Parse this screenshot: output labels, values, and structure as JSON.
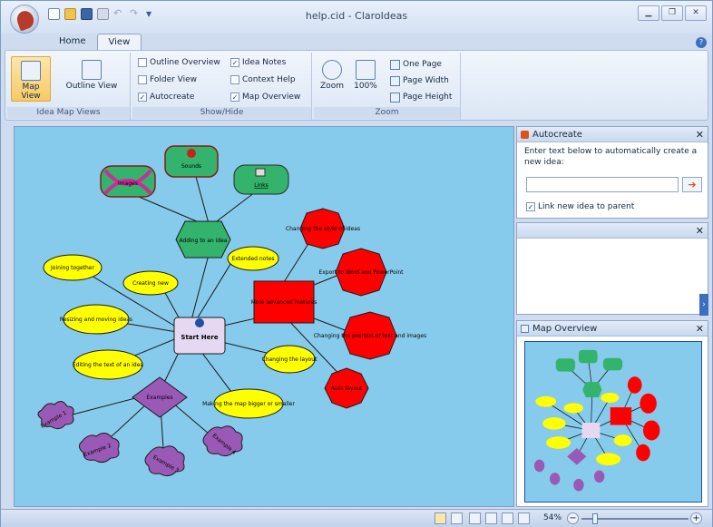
{
  "window": {
    "title": "help.cid - ClaroIdeas"
  },
  "tabs": [
    {
      "label": "Home"
    },
    {
      "label": "View"
    }
  ],
  "ribbon": {
    "idea_map_views": {
      "label": "Idea Map Views",
      "map_view": "Map View",
      "outline_view": "Outline View"
    },
    "show_hide": {
      "label": "Show/Hide",
      "outline_overview": "Outline Overview",
      "folder_view": "Folder View",
      "autocreate": "Autocreate",
      "idea_notes": "Idea Notes",
      "context_help": "Context Help",
      "map_overview": "Map Overview"
    },
    "zoom": {
      "label": "Zoom",
      "zoom": "Zoom",
      "pct": "100%",
      "one_page": "One Page",
      "page_width": "Page Width",
      "page_height": "Page Height"
    }
  },
  "map": {
    "center": "Start Here",
    "adding": "Adding to an idea",
    "more": "More advanced features",
    "examples": "Examples",
    "sounds": "Sounds",
    "images": "Images",
    "links": "Links",
    "joining": "Joining together",
    "creating": "Creating new",
    "resizing": "Resizing and moving ideas",
    "editing": "Editing the text of an idea",
    "extended": "Extended notes",
    "changing_layout": "Changing the layout",
    "making_map": "Making the map bigger or smaller",
    "changing_style": "Changing the style of ideas",
    "export": "Export to Word and PowerPoint",
    "position": "Changing the position of text and images",
    "auto_layout": "Auto layout",
    "ex1": "Example 1",
    "ex2": "Example 2",
    "ex3": "Example 3",
    "ex4": "Example 4"
  },
  "colors": {
    "canvas": "#86cbec",
    "yellow": "#ffff00",
    "red": "#ff0000",
    "green": "#33b36b",
    "purple": "#9b59b6",
    "center": "#e6d8f0"
  },
  "autocreate": {
    "title": "Autocreate",
    "instructions": "Enter text below to automatically create a new idea:",
    "input_value": "",
    "link_checkbox": "Link new idea to parent"
  },
  "map_overview": {
    "title": "Map Overview"
  },
  "status": {
    "zoom": "54%"
  }
}
